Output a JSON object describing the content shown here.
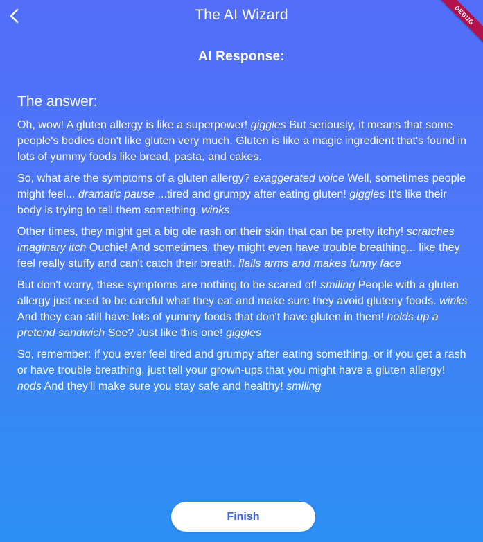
{
  "appbar": {
    "title": "The AI Wizard",
    "back_icon": "chevron-left-icon"
  },
  "debug_banner": "DEBUG",
  "heading": "AI Response:",
  "answer": {
    "title": "The answer:",
    "paragraphs": [
      [
        {
          "t": "Oh, wow! A gluten allergy is like a superpower! "
        },
        {
          "t": "giggles",
          "i": true
        },
        {
          "t": " But seriously, it means that some people's bodies don't like gluten very much. Gluten is like a magic ingredient that's found in lots of yummy foods like bread, pasta, and cakes."
        }
      ],
      [
        {
          "t": "So, what are the symptoms of a gluten allergy? "
        },
        {
          "t": "exaggerated voice",
          "i": true
        },
        {
          "t": " Well, sometimes people might feel... "
        },
        {
          "t": "dramatic pause",
          "i": true
        },
        {
          "t": " ...tired and grumpy after eating gluten! "
        },
        {
          "t": "giggles",
          "i": true
        },
        {
          "t": " It's like their body is trying to tell them something. "
        },
        {
          "t": "winks",
          "i": true
        }
      ],
      [
        {
          "t": "Other times, they might get a big ole rash on their skin that can be pretty itchy! "
        },
        {
          "t": "scratches imaginary itch",
          "i": true
        },
        {
          "t": " Ouchie! And sometimes, they might even have trouble breathing... like they feel really stuffy and can't catch their breath. "
        },
        {
          "t": "flails arms and makes funny face",
          "i": true
        }
      ],
      [
        {
          "t": "But don't worry, these symptoms are nothing to be scared of! "
        },
        {
          "t": "smiling",
          "i": true
        },
        {
          "t": " People with a gluten allergy just need to be careful what they eat and make sure they avoid gluteny foods. "
        },
        {
          "t": "winks",
          "i": true
        },
        {
          "t": " And they can still have lots of yummy foods that don't have gluten in them! "
        },
        {
          "t": "holds up a pretend sandwich",
          "i": true
        },
        {
          "t": " See? Just like this one! "
        },
        {
          "t": "giggles",
          "i": true
        }
      ],
      [
        {
          "t": "So, remember: if you ever feel tired and grumpy after eating something, or if you get a rash or have trouble breathing, just tell your grown-ups that you might have a gluten allergy! "
        },
        {
          "t": "nods",
          "i": true
        },
        {
          "t": " And they'll make sure you stay safe and healthy! "
        },
        {
          "t": "smiling",
          "i": true
        }
      ]
    ]
  },
  "finish_button": {
    "label": "Finish"
  },
  "colors": {
    "background_top": "#536ef9",
    "background_bottom": "#2c8ff4",
    "button_text": "#3d62e6",
    "debug_banner": "#b3134a"
  }
}
